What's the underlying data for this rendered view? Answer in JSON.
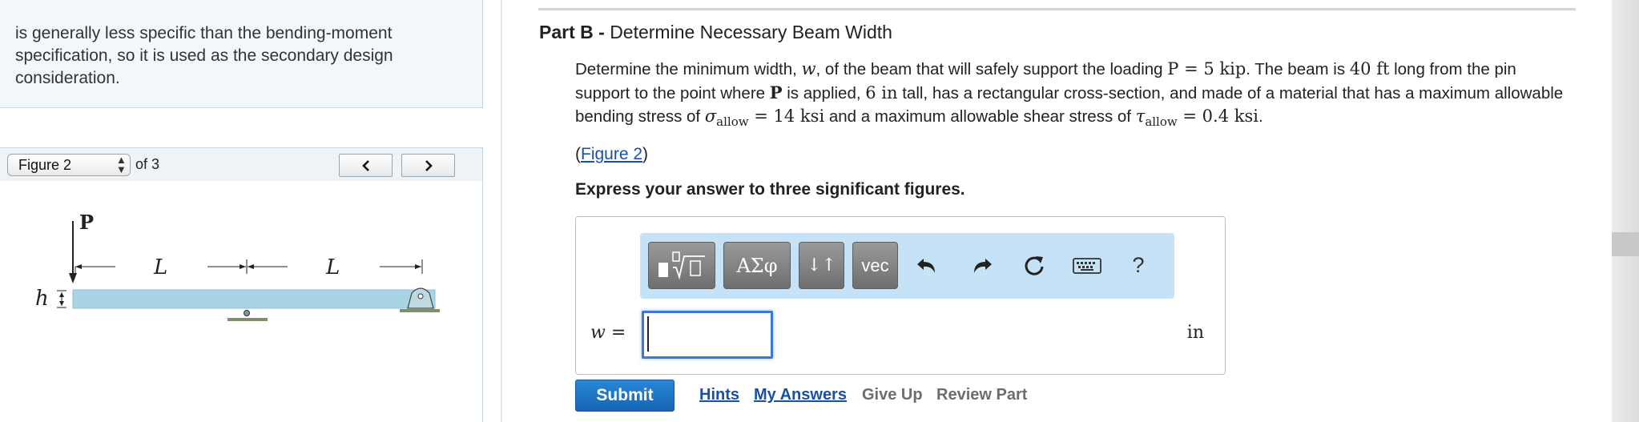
{
  "left_panel": {
    "hint_text": "is generally less specific than the bending-moment specification, so it is used as the secondary design consideration."
  },
  "figure_nav": {
    "selected": "Figure 2",
    "of_label": "of 3",
    "prev_icon": "chevron-left-icon",
    "next_icon": "chevron-right-icon"
  },
  "figure": {
    "label_P": "P",
    "label_L1": "L",
    "label_L2": "L",
    "label_h": "h"
  },
  "part": {
    "prefix": "Part B - ",
    "title": "Determine Necessary Beam Width"
  },
  "problem": {
    "t1": "Determine the minimum width, ",
    "w": "w",
    "t2": ", of the beam that will safely support the loading ",
    "P_eq": "P = 5 kip",
    "t3": ". The beam is ",
    "len": "40 ft",
    "t4": " long from the pin support to the point where ",
    "P_bold": "P",
    "t5": " is applied, ",
    "height": "6 in",
    "t6": " tall, has a rectangular cross-section, and made of a material that has a maximum allowable bending stress of ",
    "sigma": "σ",
    "allow1": "allow",
    "sigma_val": " = 14 ksi",
    "t7": " and a maximum allowable shear stress of ",
    "tau": "τ",
    "allow2": "allow",
    "tau_val": " = 0.4 ksi",
    "t8": "."
  },
  "figure_link": {
    "open": "(",
    "text": "Figure 2",
    "close": ")"
  },
  "instruction": "Express your answer to three significant figures.",
  "toolbar": {
    "templates_icon": "templates-icon",
    "greek_label": "ΑΣφ",
    "updown_label": "↓↑",
    "vec_label": "vec",
    "undo_icon": "undo-icon",
    "redo_icon": "redo-icon",
    "reset_icon": "reset-icon",
    "keyboard_icon": "keyboard-icon",
    "help_label": "?"
  },
  "answer": {
    "variable": "w",
    "equals": " =",
    "value": "",
    "unit": "in"
  },
  "actions": {
    "submit": "Submit",
    "hints": "Hints",
    "my_answers": "My Answers",
    "give_up": "Give Up",
    "review_part": "Review Part"
  },
  "colors": {
    "link_blue": "#1a4fa6",
    "submit_blue": "#1e75c5",
    "toolbar_bg": "#c6e2f6",
    "beam_fill": "#a9d4e3"
  }
}
